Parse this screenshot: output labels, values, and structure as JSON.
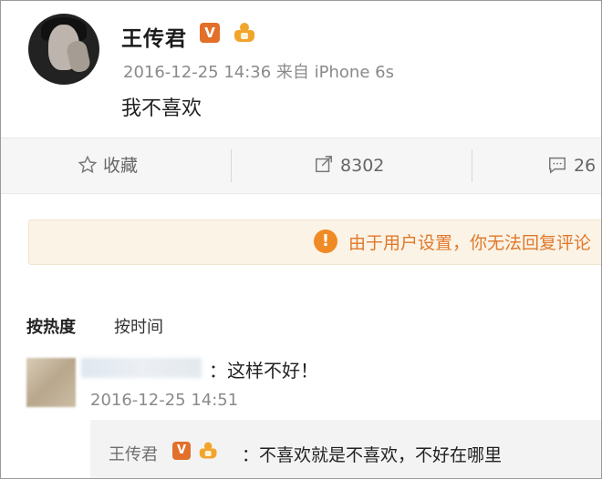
{
  "post": {
    "username": "王传君",
    "verified_badge": "V",
    "meta": "2016-12-25 14:36 来自 iPhone 6s",
    "text": "我不喜欢"
  },
  "actions": {
    "favorite_label": "收藏",
    "repost_count": "8302",
    "comment_count": "26"
  },
  "notice": {
    "icon": "!",
    "text": "由于用户设置，你无法回复评论"
  },
  "sort": {
    "by_hot": "按热度",
    "by_time": "按时间"
  },
  "comment": {
    "text": "：这样不好！",
    "time": "2016-12-25 14:51"
  },
  "reply": {
    "username": "王传君",
    "verified_badge": "V",
    "text": "：不喜欢就是不喜欢，不好在哪里"
  }
}
